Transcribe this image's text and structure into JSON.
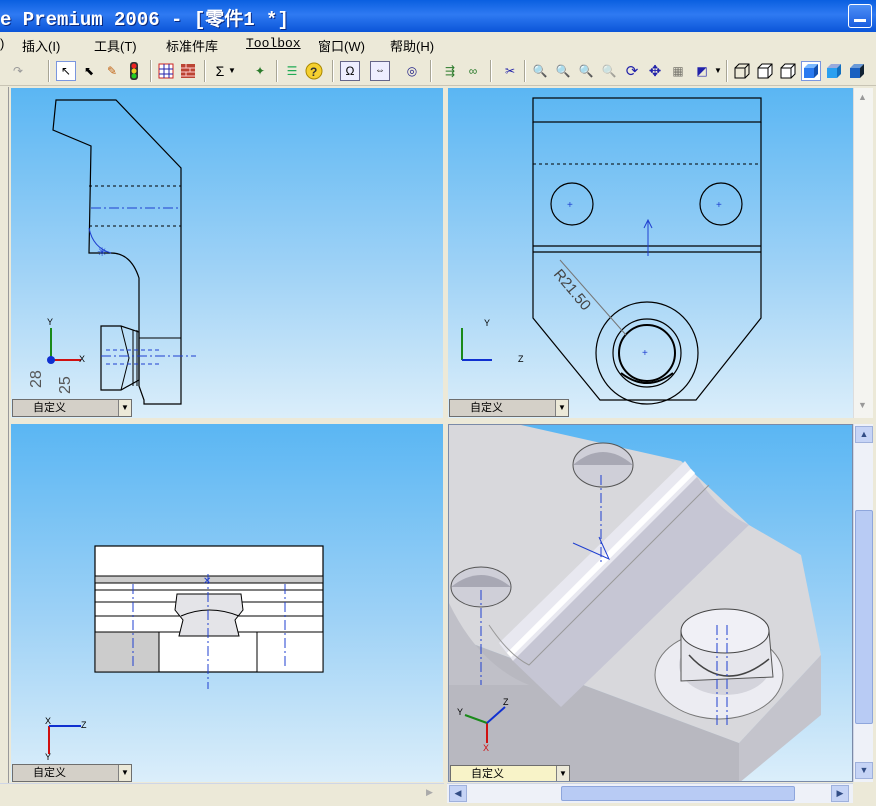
{
  "window": {
    "title": "e Premium 2006 - [零件1 *]"
  },
  "menu": [
    ")",
    "插入(I)",
    "工具(T)",
    "标准件库",
    "Toolbox",
    "窗口(W)",
    "帮助(H)"
  ],
  "toolbar_icons": [
    "redo-icon",
    "select-arrow-icon",
    "select-other-icon",
    "sketch-icon",
    "traffic-light-icon",
    "grid-icon",
    "brick-icon",
    "equation-icon",
    "measure-icon",
    "mass-props-icon",
    "list-icon",
    "help-icon",
    "section-icon",
    "dimension-icon",
    "target-icon",
    "rebuild-icon",
    "link-icon",
    "cross-icon",
    "zoom-fit-icon",
    "zoom-area-icon",
    "zoom-in-icon",
    "zoom-prev-icon",
    "rotate-icon",
    "pan-icon",
    "lighting-icon",
    "view-orient-icon",
    "wireframe-icon",
    "hidden-lines-icon",
    "hidden-removed-icon",
    "shaded-edges-icon",
    "shaded-icon",
    "perspective-icon"
  ],
  "viewports": {
    "top_left": {
      "orientation": "自定义",
      "dims": [
        "28",
        "25"
      ],
      "axes": [
        "Y",
        "X"
      ]
    },
    "top_right": {
      "orientation": "自定义",
      "radius_label": "R21.50",
      "axes": [
        "Y",
        "Z"
      ]
    },
    "bottom_left": {
      "orientation": "自定义",
      "axes": [
        "X",
        "Y",
        "Z"
      ]
    },
    "bottom_right": {
      "orientation": "自定义",
      "axes": [
        "Y",
        "X",
        "Z"
      ]
    }
  },
  "colors": {
    "title_bar": "#0a5fe0",
    "viewport_top": "#5ab6f3",
    "viewport_bottom": "#dbeefa",
    "centerline": "#1f3fd0",
    "axis_x": "#d01010",
    "axis_y": "#1a8a1a",
    "axis_z": "#1030d0"
  }
}
